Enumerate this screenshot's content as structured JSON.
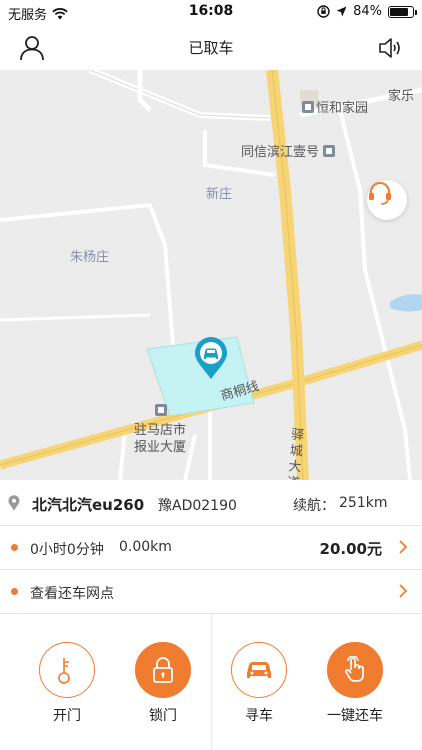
{
  "status_bar": {
    "carrier": "无服务",
    "time": "16:08",
    "battery_text": "84%",
    "battery_level": 0.84
  },
  "nav": {
    "title": "已取车",
    "user_icon": "user-icon",
    "sound_icon": "speaker-icon"
  },
  "map": {
    "labels": {
      "jiale": "家乐",
      "henghe": "恒和家园",
      "tongxin": "同信滨江壹号",
      "xinzhuang": "新庄",
      "zhuyang": "朱杨庄",
      "shangtong": "商桐线",
      "yicheng": "驿城大道",
      "newspaper_l1": "驻马店市",
      "newspaper_l2": "报业大厦"
    },
    "support_icon": "headset-icon",
    "car_marker_icon": "car-location-pin-icon"
  },
  "vehicle": {
    "name": "北汽北汽eu260",
    "plate": "豫AD02190",
    "range_label": "续航：",
    "range_value": "251km"
  },
  "trip": {
    "duration": "0小时0分钟",
    "distance": "0.00km",
    "fee": "20.00元"
  },
  "return_point": {
    "label": "查看还车网点"
  },
  "actions": [
    {
      "label": "开门",
      "icon": "key-icon"
    },
    {
      "label": "锁门",
      "icon": "lock-icon"
    },
    {
      "label": "寻车",
      "icon": "car-icon"
    },
    {
      "label": "一键还车",
      "icon": "hand-tap-icon"
    }
  ],
  "colors": {
    "accent": "#f07c2f",
    "marker": "#1a9fc9",
    "zone": "#c5f2f2",
    "road_main": "#f7d576"
  }
}
